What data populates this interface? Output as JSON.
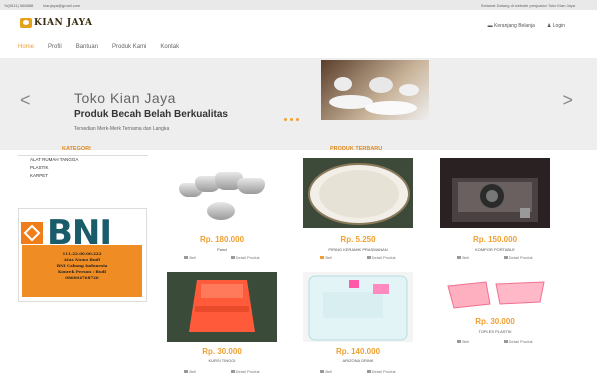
{
  "topbar": {
    "phone": "%(0811) 568888",
    "email": "kianjaya@gmail.com",
    "welcome": "Selamat Datang di website penjualan Toko Kian Jaya"
  },
  "header": {
    "logo_text": "KIAN JAYA",
    "cart_label": "Keranjang Belanja",
    "login_label": "Login"
  },
  "nav": [
    "Home",
    "Profil",
    "Bantuan",
    "Produk Kami",
    "Kontak"
  ],
  "hero": {
    "title": "Toko Kian Jaya",
    "subtitle": "Produk Becah Belah Berkualitas",
    "caption": "Tersedian Merk-Merk Ternama dan Langka",
    "prev": "<",
    "next": ">"
  },
  "sidebar": {
    "title": "KATEGORI",
    "items": [
      "ALAT RUMAH TANGGA",
      "PLASTIK",
      "KARPET"
    ],
    "bank": {
      "name": "BNI",
      "lines": [
        "111.22.00.00.222",
        "Atas Nama Budi",
        "BNI Cabang Indonesia",
        "Konrek Person : Budi",
        "086004768726"
      ]
    }
  },
  "products": {
    "title": "PRODUK TERBARU",
    "buy_label": "Beli",
    "detail_label": "Detail Produk",
    "items": [
      {
        "price": "Rp. 180.000",
        "name": "Panci"
      },
      {
        "price": "Rp. 5.250",
        "name": "PIRING KERAMIK PRASMANAN"
      },
      {
        "price": "Rp. 150.000",
        "name": "KOMPOR PORTABLE"
      },
      {
        "price": "Rp. 30.000",
        "name": "KURSI TINGGI"
      },
      {
        "price": "Rp. 140.000",
        "name": "ARIZONA DRINK"
      },
      {
        "price": "Rp. 30.000",
        "name": "TOPLES PLASTIK"
      }
    ]
  }
}
